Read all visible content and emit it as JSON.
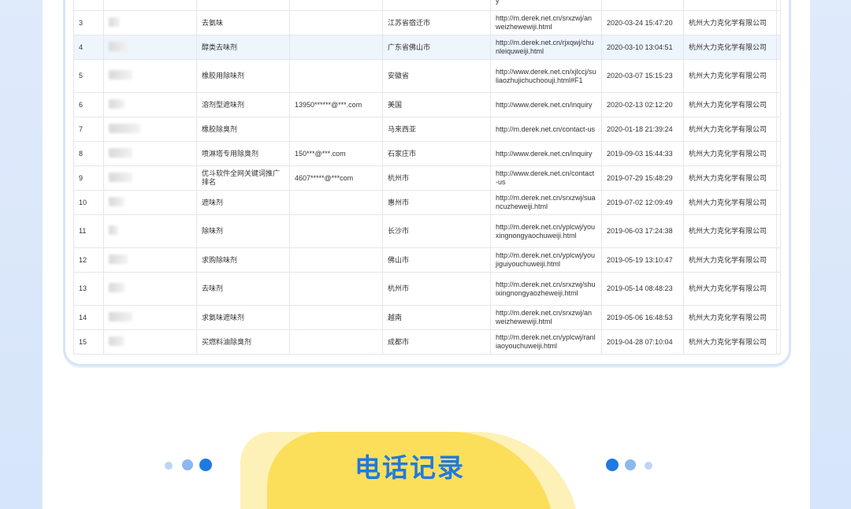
{
  "records": [
    {
      "no": "",
      "keyword": "",
      "contact": "",
      "region": "",
      "url": "y",
      "time": "",
      "company": "",
      "highlight": false
    },
    {
      "no": "3",
      "keyword": "去氨味",
      "contact": "",
      "region": "江苏省宿迁市",
      "url": "http://m.derek.net.cn/srxzwj/anweizhewewiji.html",
      "time": "2020-03-24 15:47:20",
      "company": "杭州大力克化学有限公司",
      "highlight": false
    },
    {
      "no": "4",
      "keyword": "醇类去味剂",
      "contact": "",
      "region": "广东省佛山市",
      "url": "http://m.derek.net.cn/rjxqwj/chunleiquweiji.html",
      "time": "2020-03-10 13:04:51",
      "company": "杭州大力克化学有限公司",
      "highlight": true
    },
    {
      "no": "5",
      "keyword": "橡胶用除味剂",
      "contact": "",
      "region": "安徽省",
      "url": "http://www.derek.net.cn/xjlccj/suliaozhujichuchoouji.html#F1",
      "time": "2020-03-07 15:15:23",
      "company": "杭州大力克化学有限公司",
      "highlight": false
    },
    {
      "no": "6",
      "keyword": "溶剂型遮味剂",
      "contact": "13950******@***.com",
      "region": "美国",
      "url": "http://www.derek.net.cn/inquiry",
      "time": "2020-02-13 02:12:20",
      "company": "杭州大力克化学有限公司",
      "highlight": false
    },
    {
      "no": "7",
      "keyword": "橡胶除臭剂",
      "contact": "",
      "region": "马来西亚",
      "url": "http://m.derek.net.cn/contact-us",
      "time": "2020-01-18 21:39:24",
      "company": "杭州大力克化学有限公司",
      "highlight": false
    },
    {
      "no": "8",
      "keyword": "喷淋塔专用除臭剂",
      "contact": "150***@***.com",
      "region": "石家庄市",
      "url": "http://www.derek.net.cn/inquiry",
      "time": "2019-09-03 15:44:33",
      "company": "杭州大力克化学有限公司",
      "highlight": false
    },
    {
      "no": "9",
      "keyword": "优斗软件全网关键词推广排名",
      "contact": "4607*****@***com",
      "region": "杭州市",
      "url": "http://www.derek.net.cn/contact-us",
      "time": "2019-07-29 15:48:29",
      "company": "杭州大力克化学有限公司",
      "highlight": false
    },
    {
      "no": "10",
      "keyword": "遮味剂",
      "contact": "",
      "region": "惠州市",
      "url": "http://m.derek.net.cn/srxzwj/suancuzheweiji.html",
      "time": "2019-07-02 12:09:49",
      "company": "杭州大力克化学有限公司",
      "highlight": false
    },
    {
      "no": "11",
      "keyword": "除味剂",
      "contact": "",
      "region": "长沙市",
      "url": "http://m.derek.net.cn/yplcwj/youxingnongyaochuweiji.html",
      "time": "2019-06-03 17:24:38",
      "company": "杭州大力克化学有限公司",
      "highlight": false
    },
    {
      "no": "12",
      "keyword": "求购除味剂",
      "contact": "",
      "region": "佛山市",
      "url": "http://m.derek.net.cn/yplcwj/youjiguiyouchuweiji.html",
      "time": "2019-05-19 13:10:47",
      "company": "杭州大力克化学有限公司",
      "highlight": false
    },
    {
      "no": "13",
      "keyword": "去味剂",
      "contact": "",
      "region": "杭州市",
      "url": "http://m.derek.net.cn/srxzwj/shuixingnongyaozheweiji.html",
      "time": "2019-05-14 08:48:23",
      "company": "杭州大力克化学有限公司",
      "highlight": false
    },
    {
      "no": "14",
      "keyword": "求氨味遮味剂",
      "contact": "",
      "region": "越南",
      "url": "http://m.derek.net.cn/srxzwj/anweizhewewiji.html",
      "time": "2019-05-06 16:48:53",
      "company": "杭州大力克化学有限公司",
      "highlight": false
    },
    {
      "no": "15",
      "keyword": "买燃料油除臭剂",
      "contact": "",
      "region": "成都市",
      "url": "http://m.derek.net.cn/yplcwj/ranliaoyouchuweiji.html",
      "time": "2019-04-28 07:10:04",
      "company": "杭州大力克化学有限公司",
      "highlight": false
    }
  ],
  "section": {
    "title": "电话记录"
  },
  "colors": {
    "accent": "#1f79e0",
    "dot_light": "#bcd6f7",
    "dot_mid": "#8cb8f0",
    "dot_dark": "#1f79e0",
    "ribbon": "#fbdf5b",
    "ribbon_light": "#fdf1b8"
  }
}
